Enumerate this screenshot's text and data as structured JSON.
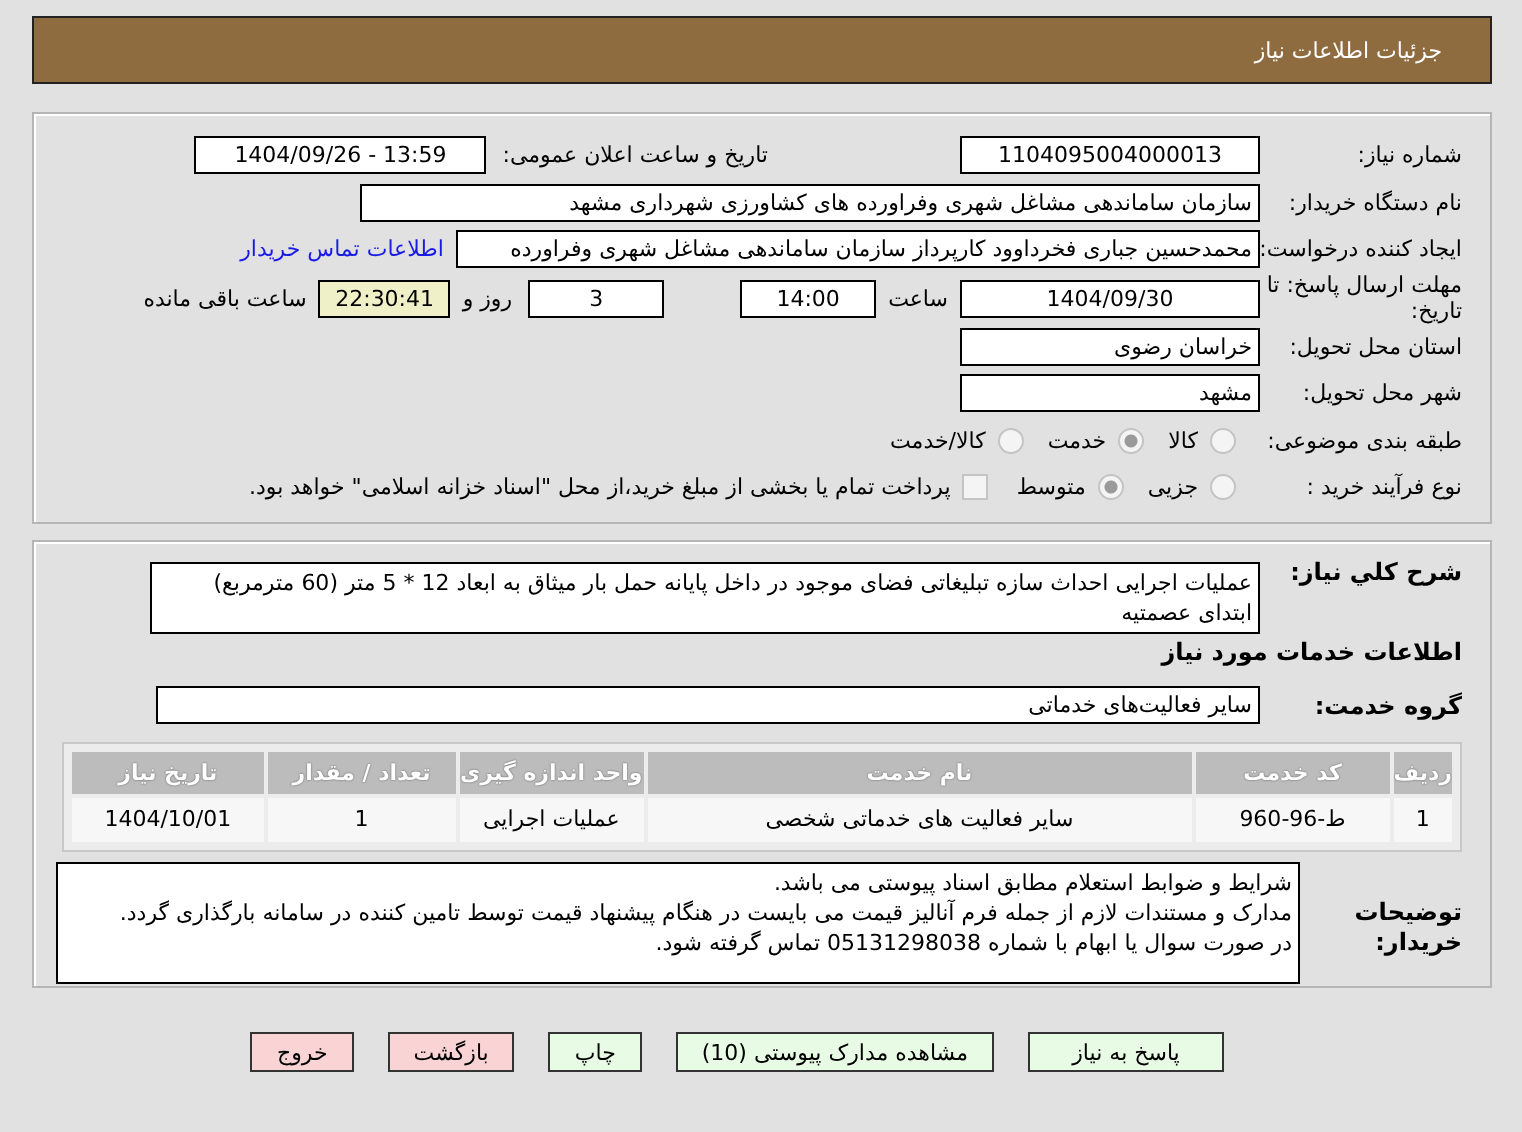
{
  "header": {
    "title": "جزئیات اطلاعات نیاز"
  },
  "details": {
    "need_number": {
      "label": "شماره نیاز:",
      "value": "1104095004000013"
    },
    "announce": {
      "label": "تاریخ و ساعت اعلان عمومی:",
      "value": "1404/09/26 - 13:59"
    },
    "buyer": {
      "label": "نام دستگاه خریدار:",
      "value": "سازمان ساماندهی مشاغل شهری وفراورده های کشاورزی شهرداری مشهد"
    },
    "creator": {
      "label": "ایجاد کننده درخواست:",
      "value": "محمدحسین جباری فخرداوود کارپرداز سازمان ساماندهی مشاغل شهری وفراورده",
      "link": "اطلاعات تماس خریدار"
    },
    "deadline": {
      "label": "مهلت ارسال پاسخ: تا تاریخ:",
      "date": "1404/09/30",
      "time_label": "ساعت",
      "time": "14:00",
      "days": "3",
      "days_label": "روز و",
      "remaining": "22:30:41",
      "remaining_label": "ساعت باقی مانده"
    },
    "province": {
      "label": "استان محل تحویل:",
      "value": "خراسان رضوی"
    },
    "city": {
      "label": "شهر محل تحویل:",
      "value": "مشهد"
    },
    "category": {
      "label": "طبقه بندی موضوعی:",
      "options": [
        {
          "label": "کالا",
          "selected": false
        },
        {
          "label": "خدمت",
          "selected": true
        },
        {
          "label": "کالا/خدمت",
          "selected": false
        }
      ]
    },
    "process": {
      "label": "نوع فرآیند خرید :",
      "options": [
        {
          "label": "جزیی",
          "selected": false
        },
        {
          "label": "متوسط",
          "selected": true
        }
      ],
      "payment": {
        "checked": false,
        "label": "پرداخت تمام یا بخشی از مبلغ خرید،از محل \"اسناد خزانه اسلامی\" خواهد بود."
      }
    }
  },
  "service": {
    "description": {
      "label": "شرح کلي نياز:",
      "value": "عملیات اجرایی احداث سازه تبلیغاتی فضای موجود در داخل پایانه حمل بار میثاق به ابعاد 12 * 5 متر (60 مترمربع) ابتدای عصمتیه"
    },
    "heading": "اطلاعات خدمات مورد نیاز",
    "group": {
      "label": "گروه خدمت:",
      "value": "سایر فعالیت‌های خدماتی"
    },
    "table": {
      "columns": [
        "ردیف",
        "کد خدمت",
        "نام خدمت",
        "واحد اندازه گیری",
        "تعداد / مقدار",
        "تاریخ نیاز"
      ],
      "rows": [
        [
          "1",
          "ط-96-960",
          "سایر فعالیت های خدماتی شخصی",
          "عملیات اجرایی",
          "1",
          "1404/10/01"
        ]
      ]
    },
    "notes": {
      "label": "توضیحات خریدار:",
      "value": "شرایط و ضوابط استعلام مطابق اسناد پیوستی می باشد.\nمدارک و مستندات لازم از جمله فرم آنالیز قیمت می بایست در هنگام پیشنهاد قیمت توسط تامین کننده در سامانه بارگذاری گردد.\nدر صورت سوال یا ابهام با شماره 05131298038 تماس گرفته شود."
    }
  },
  "buttons": [
    {
      "label": "پاسخ به نیاز",
      "color": "#e8fbe4"
    },
    {
      "label": "مشاهده مدارک پیوستی (10)",
      "color": "#e8fbe4"
    },
    {
      "label": "چاپ",
      "color": "#e8fbe4"
    },
    {
      "label": "بازگشت",
      "color": "#fad4d4"
    },
    {
      "label": "خروج",
      "color": "#fad4d4"
    }
  ]
}
